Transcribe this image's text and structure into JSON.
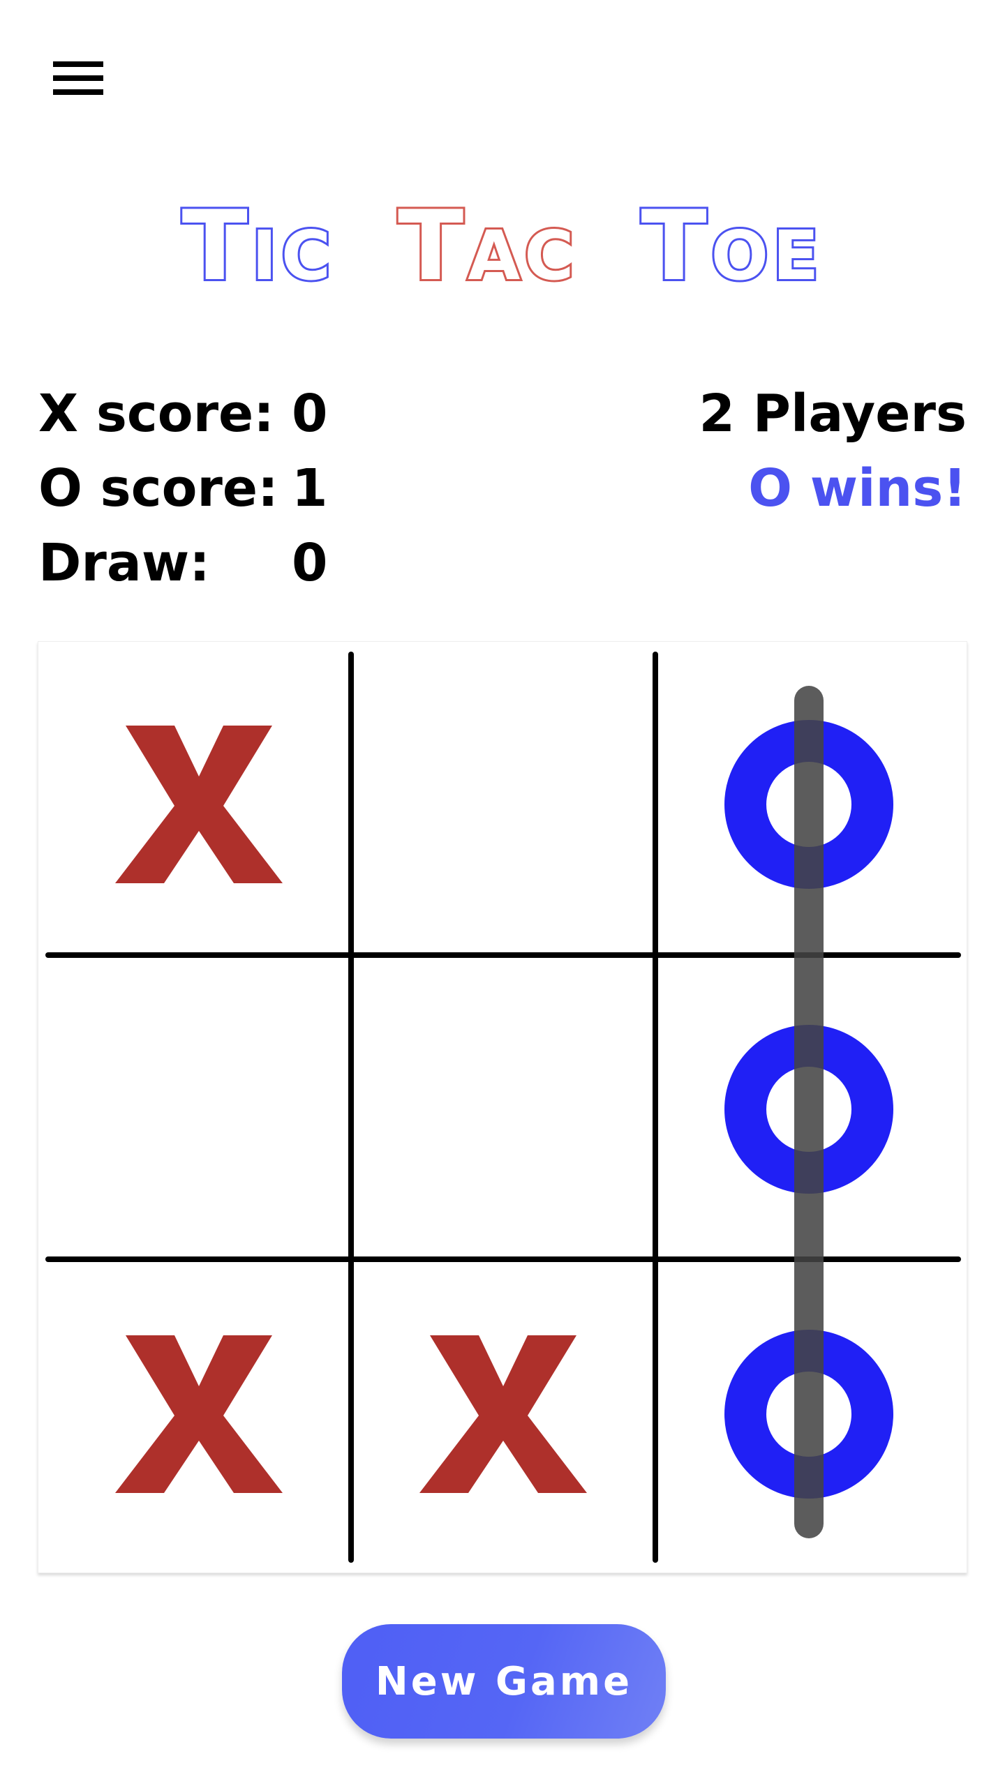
{
  "header": {
    "menu_icon": "hamburger-menu-icon"
  },
  "title": {
    "words": [
      {
        "text": "Tic",
        "color": "#4b52f0"
      },
      {
        "text": "Tac",
        "color": "#d45a52"
      },
      {
        "text": "Toe",
        "color": "#4b52f0"
      }
    ]
  },
  "scores": {
    "rows": [
      {
        "label": "X score:",
        "value": "0"
      },
      {
        "label": "O score:",
        "value": "1"
      },
      {
        "label": "Draw:",
        "value": "0"
      }
    ]
  },
  "status": {
    "mode": "2 Players",
    "result": "O wins!",
    "result_color": "#4b52f0"
  },
  "board": {
    "cells": [
      [
        "X",
        "",
        "O"
      ],
      [
        "",
        "",
        "O"
      ],
      [
        "X",
        "X",
        "O"
      ]
    ],
    "winning_line": {
      "type": "column",
      "index": 2
    },
    "colors": {
      "x": "#ae302b",
      "o": "#2020f5",
      "grid": "#000000",
      "win_line": "#444444"
    }
  },
  "actions": {
    "new_game_label": "New Game"
  }
}
